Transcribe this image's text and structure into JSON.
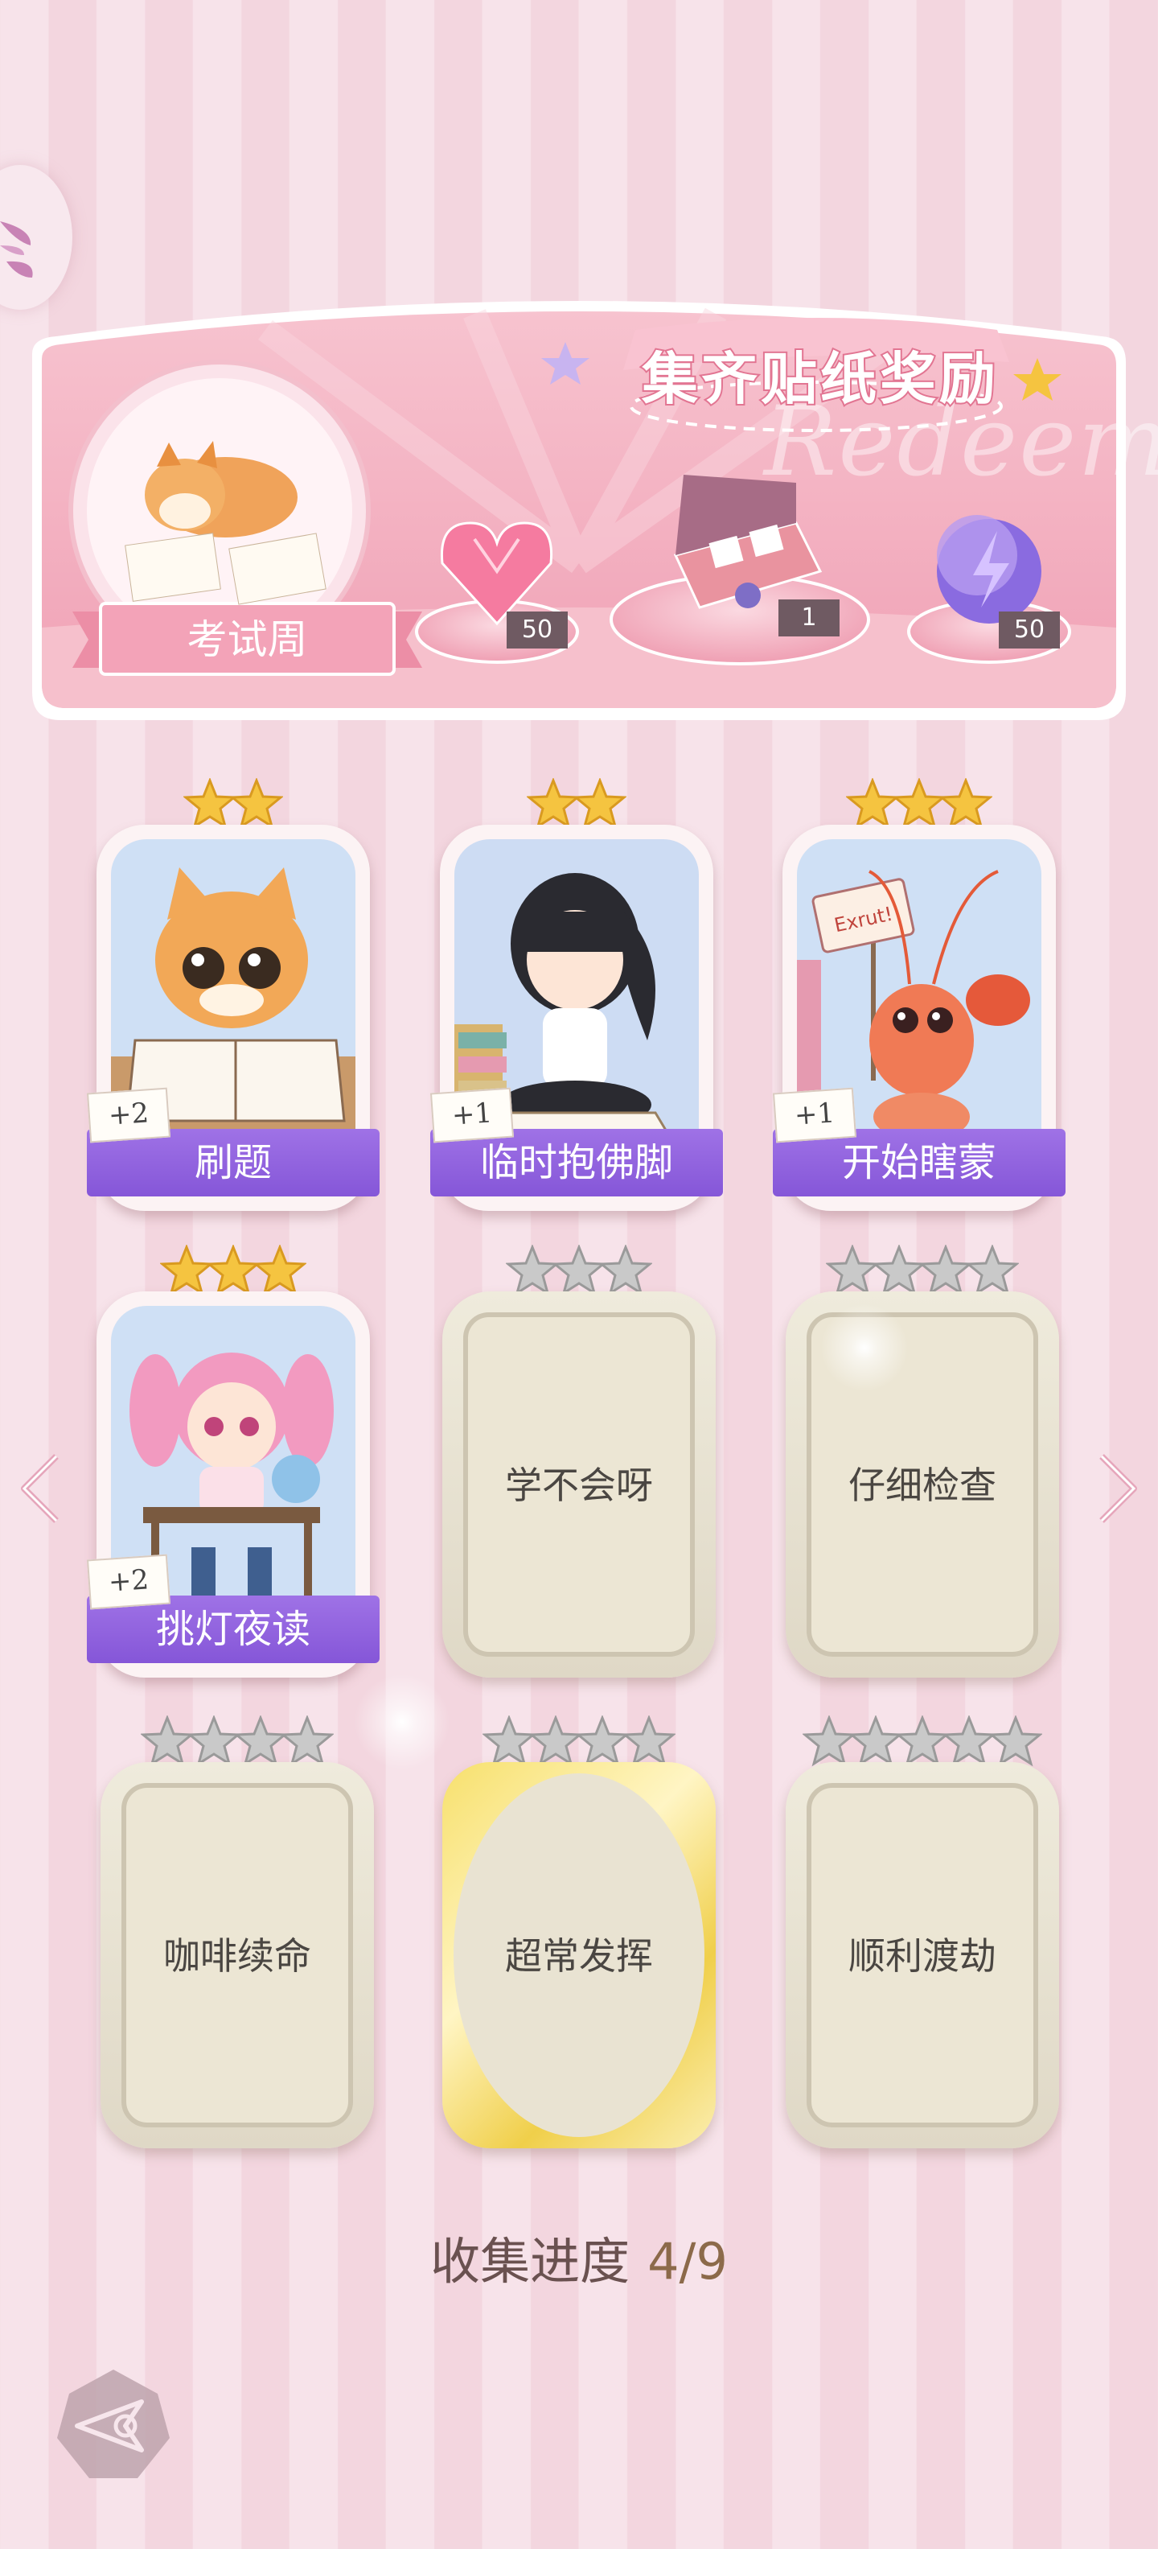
{
  "banner": {
    "title": "集齐贴纸奖励",
    "watermark": "Redeem",
    "theme_label": "考试周",
    "rewards": [
      {
        "icon": "pink-heart-gem-icon",
        "count": "50"
      },
      {
        "icon": "gift-box-icon",
        "count": "1"
      },
      {
        "icon": "lightning-orb-icon",
        "count": "50"
      }
    ]
  },
  "cards": [
    {
      "name": "刷题",
      "stars": 2,
      "unlocked": true,
      "bonus": "+2",
      "art": "cat-studying"
    },
    {
      "name": "临时抱佛脚",
      "stars": 2,
      "unlocked": true,
      "bonus": "+1",
      "art": "girl-praying-books"
    },
    {
      "name": "开始瞎蒙",
      "stars": 3,
      "unlocked": true,
      "bonus": "+1",
      "art": "shrimp-with-sign",
      "art_text": "Exrut!"
    },
    {
      "name": "挑灯夜读",
      "stars": 3,
      "unlocked": true,
      "bonus": "+2",
      "art": "girl-at-desk"
    },
    {
      "name": "学不会呀",
      "stars": 3,
      "unlocked": false
    },
    {
      "name": "仔细检查",
      "stars": 4,
      "unlocked": false
    },
    {
      "name": "咖啡续命",
      "stars": 4,
      "unlocked": false
    },
    {
      "name": "超常发挥",
      "stars": 4,
      "unlocked": false,
      "gold": true
    },
    {
      "name": "顺利渡劫",
      "stars": 5,
      "unlocked": false
    }
  ],
  "progress": {
    "label": "收集进度",
    "value": "4/9"
  },
  "colors": {
    "ribbon": "#8f61de",
    "banner_pink": "#f3a3b8",
    "star_gold": "#f5c440",
    "star_silver": "#c9c9c9"
  }
}
